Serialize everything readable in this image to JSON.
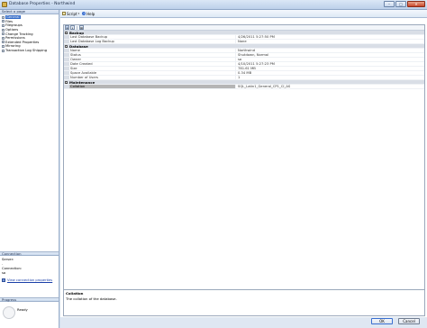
{
  "window": {
    "title": "Database Properties - Northwind"
  },
  "left": {
    "header": "Select a page",
    "pages": [
      {
        "label": "General",
        "selected": true
      },
      {
        "label": "Files",
        "selected": false
      },
      {
        "label": "Filegroups",
        "selected": false
      },
      {
        "label": "Options",
        "selected": false
      },
      {
        "label": "Change Tracking",
        "selected": false
      },
      {
        "label": "Permissions",
        "selected": false
      },
      {
        "label": "Extended Properties",
        "selected": false
      },
      {
        "label": "Mirroring",
        "selected": false
      },
      {
        "label": "Transaction Log Shipping",
        "selected": false
      }
    ],
    "connection": {
      "header": "Connection",
      "server_label": "Server:",
      "server_value": ".",
      "connection_label": "Connection:",
      "connection_value": "sa",
      "link": "View connection properties"
    },
    "progress": {
      "header": "Progress",
      "status": "Ready"
    }
  },
  "toolbar": {
    "script": "Script",
    "help": "Help"
  },
  "grid": {
    "categories": [
      {
        "name": "Backup",
        "rows": [
          {
            "name": "Last Database Backup",
            "value": "4/26/2011 5:27:50 PM"
          },
          {
            "name": "Last Database Log Backup",
            "value": "None"
          }
        ]
      },
      {
        "name": "Database",
        "rows": [
          {
            "name": "Name",
            "value": "Northwind"
          },
          {
            "name": "Status",
            "value": "Shutdown, Normal"
          },
          {
            "name": "Owner",
            "value": "sa"
          },
          {
            "name": "Date Created",
            "value": "4/10/2011 5:27:23 PM"
          },
          {
            "name": "Size",
            "value": "781.61 MB"
          },
          {
            "name": "Space Available",
            "value": "0.34 MB"
          },
          {
            "name": "Number of Users",
            "value": "1"
          }
        ]
      },
      {
        "name": "Maintenance",
        "rows": [
          {
            "name": "Collation",
            "value": "SQL_Latin1_General_CP1_CI_AS",
            "selected": true
          }
        ]
      }
    ]
  },
  "description": {
    "title": "Collation",
    "text": "The collation of the database."
  },
  "buttons": {
    "ok": "OK",
    "cancel": "Cancel"
  }
}
